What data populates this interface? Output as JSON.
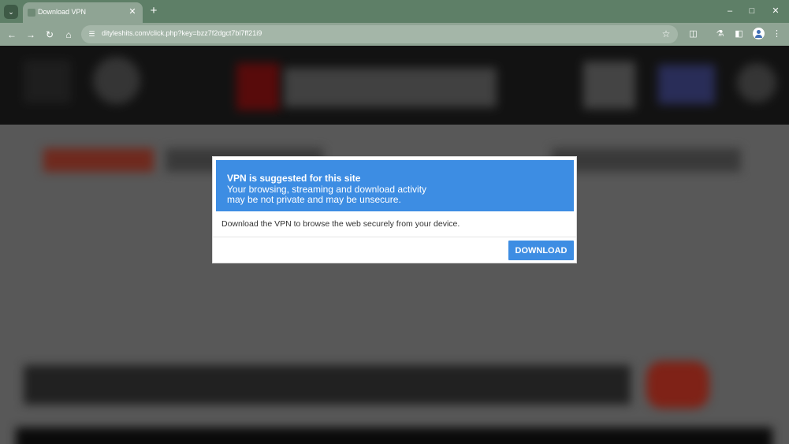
{
  "browser": {
    "tab_title": "Download VPN",
    "url": "dityleshits.com/click.php?key=bzz7f2dgct7bl7ff21i9",
    "icons": {
      "tab_search": "chevron-down-icon",
      "close_tab": "close-icon",
      "new_tab": "plus-icon",
      "minimize": "minimize-icon",
      "maximize": "maximize-icon",
      "close_window": "close-icon",
      "back": "arrow-left-icon",
      "forward": "arrow-right-icon",
      "reload": "reload-icon",
      "home": "home-icon",
      "site_info": "tune-icon",
      "bookmark": "star-icon",
      "extensions": "puzzle-icon",
      "labs": "flask-icon",
      "side_panel": "side-panel-icon",
      "profile": "avatar-icon",
      "menu": "kebab-menu-icon"
    }
  },
  "modal": {
    "title": "VPN is suggested for this site",
    "line1": "Your browsing, streaming and download activity",
    "line2": "may be not private and may be unsecure.",
    "body": "Download the VPN to browse the web securely from your device.",
    "button_label": "DOWNLOAD"
  },
  "colors": {
    "chrome": "#5e7f67",
    "toolbar": "#8fa494",
    "modal_accent": "#3d8de3"
  }
}
